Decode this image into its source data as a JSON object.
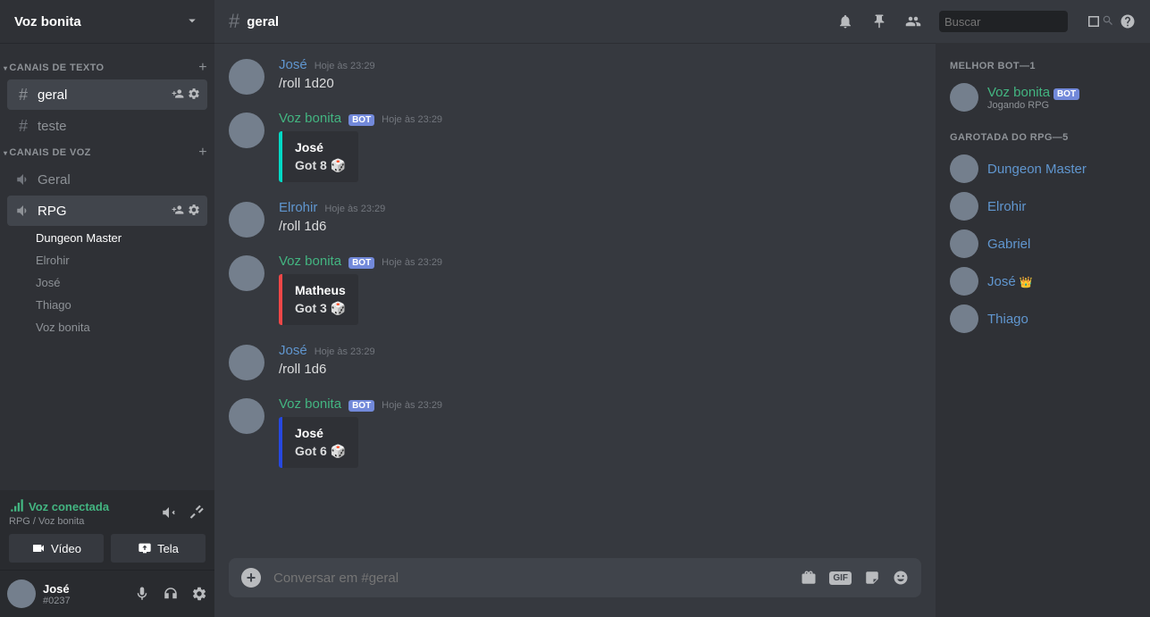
{
  "server": {
    "name": "Voz bonita"
  },
  "categories": [
    {
      "name": "CANAIS DE TEXTO",
      "channels": [
        {
          "name": "geral",
          "type": "text",
          "active": true
        },
        {
          "name": "teste",
          "type": "text",
          "active": false
        }
      ]
    },
    {
      "name": "CANAIS DE VOZ",
      "channels": [
        {
          "name": "Geral",
          "type": "voice",
          "active": false
        },
        {
          "name": "RPG",
          "type": "voice",
          "active": true,
          "users": [
            {
              "name": "Dungeon Master",
              "active": true
            },
            {
              "name": "Elrohir"
            },
            {
              "name": "José"
            },
            {
              "name": "Thiago"
            },
            {
              "name": "Voz bonita"
            }
          ]
        }
      ]
    }
  ],
  "voicePanel": {
    "status": "Voz conectada",
    "path": "RPG / Voz bonita",
    "videoBtn": "Vídeo",
    "screenBtn": "Tela"
  },
  "currentUser": {
    "name": "José",
    "tag": "#0237"
  },
  "topbar": {
    "channel": "geral",
    "searchPlaceholder": "Buscar"
  },
  "messages": [
    {
      "author": "José",
      "color": "blue",
      "ts": "Hoje às 23:29",
      "body": "/roll 1d20"
    },
    {
      "author": "Voz bonita",
      "color": "green",
      "bot": "BOT",
      "ts": "Hoje às 23:29",
      "embed": {
        "bar": "cyan",
        "title": "José",
        "desc": "Got 8",
        "dice": true
      }
    },
    {
      "author": "Elrohir",
      "color": "blue",
      "ts": "Hoje às 23:29",
      "body": "/roll 1d6"
    },
    {
      "author": "Voz bonita",
      "color": "green",
      "bot": "BOT",
      "ts": "Hoje às 23:29",
      "embed": {
        "bar": "red",
        "title": "Matheus",
        "desc": "Got 3",
        "dice": true
      }
    },
    {
      "author": "José",
      "color": "blue",
      "ts": "Hoje às 23:29",
      "body": "/roll 1d6"
    },
    {
      "author": "Voz bonita",
      "color": "green",
      "bot": "BOT",
      "ts": "Hoje às 23:29",
      "embed": {
        "bar": "blueBar",
        "title": "José",
        "desc": "Got 6",
        "dice": true
      }
    }
  ],
  "input": {
    "placeholder": "Conversar em #geral"
  },
  "memberList": {
    "groups": [
      {
        "label": "MELHOR BOT—1",
        "members": [
          {
            "name": "Voz bonita",
            "color": "green",
            "bot": "BOT",
            "sub": "Jogando RPG"
          }
        ]
      },
      {
        "label": "GAROTADA DO RPG—5",
        "members": [
          {
            "name": "Dungeon Master",
            "color": "blue"
          },
          {
            "name": "Elrohir",
            "color": "blue"
          },
          {
            "name": "Gabriel",
            "color": "blue"
          },
          {
            "name": "José",
            "color": "blue",
            "crown": true
          },
          {
            "name": "Thiago",
            "color": "blue"
          }
        ]
      }
    ]
  }
}
